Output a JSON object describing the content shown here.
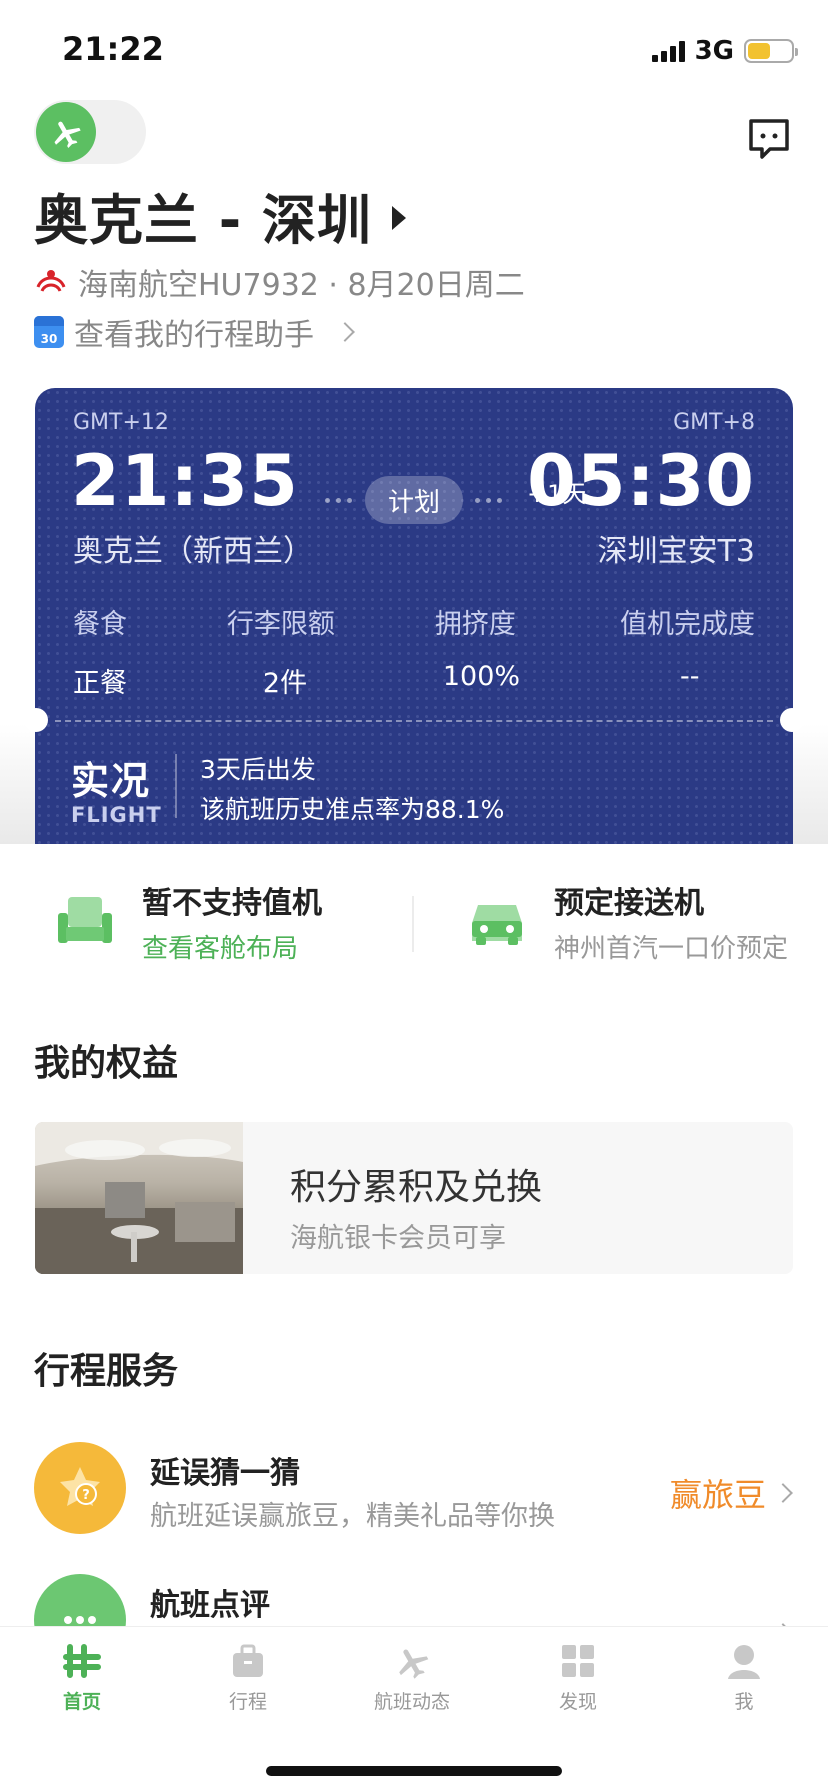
{
  "status_bar": {
    "time": "21:22",
    "network": "3G"
  },
  "header": {
    "route": "奥克兰 - 深圳",
    "airline_flight": "海南航空HU7932 · 8月20日周二",
    "assistant": "查看我的行程助手"
  },
  "calendar_icon_day": "30",
  "flight_card": {
    "dep_gmt": "GMT+12",
    "arr_gmt": "GMT+8",
    "dep_time": "21:35",
    "arr_time": "05:30",
    "plus_day": "+1天",
    "status": "计划",
    "dep_city": "奥克兰（新西兰）",
    "arr_city": "深圳宝安T3",
    "info": [
      {
        "label": "餐食",
        "value": "正餐"
      },
      {
        "label": "行李限额",
        "value": "2件"
      },
      {
        "label": "拥挤度",
        "value": "100%"
      },
      {
        "label": "值机完成度",
        "value": "--"
      }
    ],
    "live_cn": "实况",
    "live_en": "FLIGHT",
    "live_line1": "3天后出发",
    "live_line2": "该航班历史准点率为88.1%"
  },
  "quick_actions": [
    {
      "title": "暂不支持值机",
      "sub": "查看客舱布局"
    },
    {
      "title": "预定接送机",
      "sub": "神州首汽一口价预定"
    }
  ],
  "benefits": {
    "section_title": "我的权益",
    "title": "积分累积及兑换",
    "sub": "海航银卡会员可享"
  },
  "services": {
    "section_title": "行程服务",
    "items": [
      {
        "title": "延误猜一猜",
        "sub": "航班延误赢旅豆，精美礼品等你换",
        "action": "赢旅豆"
      },
      {
        "title": "航班点评",
        "sub": ""
      }
    ]
  },
  "tabs": [
    {
      "label": "首页"
    },
    {
      "label": "行程"
    },
    {
      "label": "航班动态"
    },
    {
      "label": "发现"
    },
    {
      "label": "我"
    }
  ],
  "colors": {
    "accent_green": "#4db157",
    "card_blue": "#2b3a85",
    "orange": "#f08b2a"
  }
}
